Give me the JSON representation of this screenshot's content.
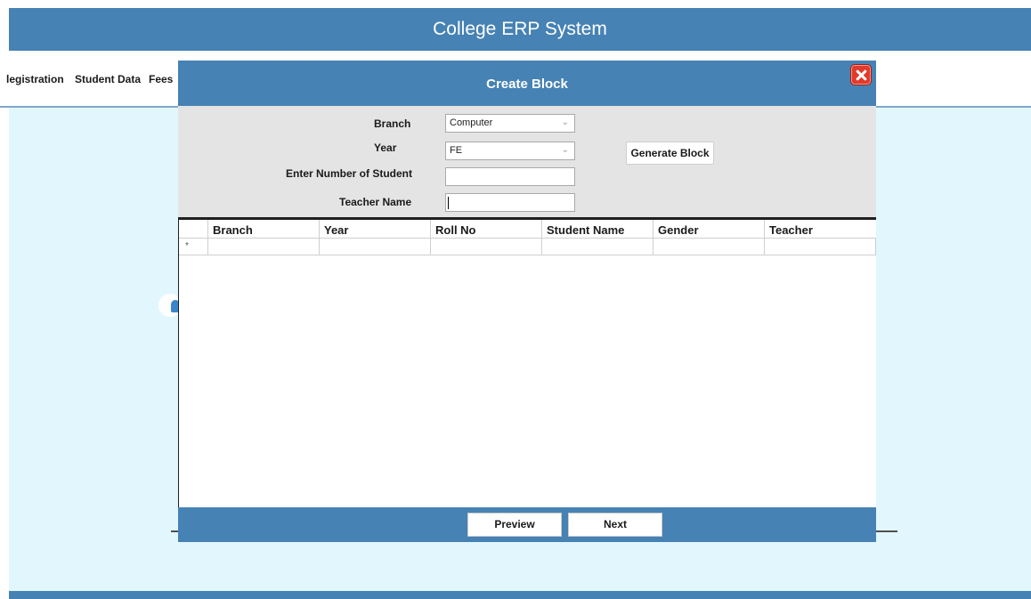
{
  "app": {
    "title": "College ERP System"
  },
  "menu": {
    "items": [
      "Registration",
      "Student Data",
      "Fees"
    ],
    "partial_first": "legistration"
  },
  "dialog": {
    "title": "Create Block",
    "close_icon": "close-icon",
    "form": {
      "branch_label": "Branch",
      "branch_value": "Computer",
      "year_label": "Year",
      "year_value": "FE",
      "num_students_label": "Enter Number of Student",
      "num_students_value": "",
      "teacher_label": "Teacher Name",
      "teacher_value": "",
      "generate_label": "Generate Block"
    },
    "grid": {
      "columns": [
        "Branch",
        "Year",
        "Roll No",
        "Student Name",
        "Gender",
        "Teacher"
      ],
      "new_row_marker": "*"
    },
    "footer": {
      "preview_label": "Preview",
      "next_label": "Next"
    }
  },
  "colors": {
    "accent": "#4682b4",
    "content_bg": "#e2f6fd",
    "close": "#e03a2c"
  }
}
